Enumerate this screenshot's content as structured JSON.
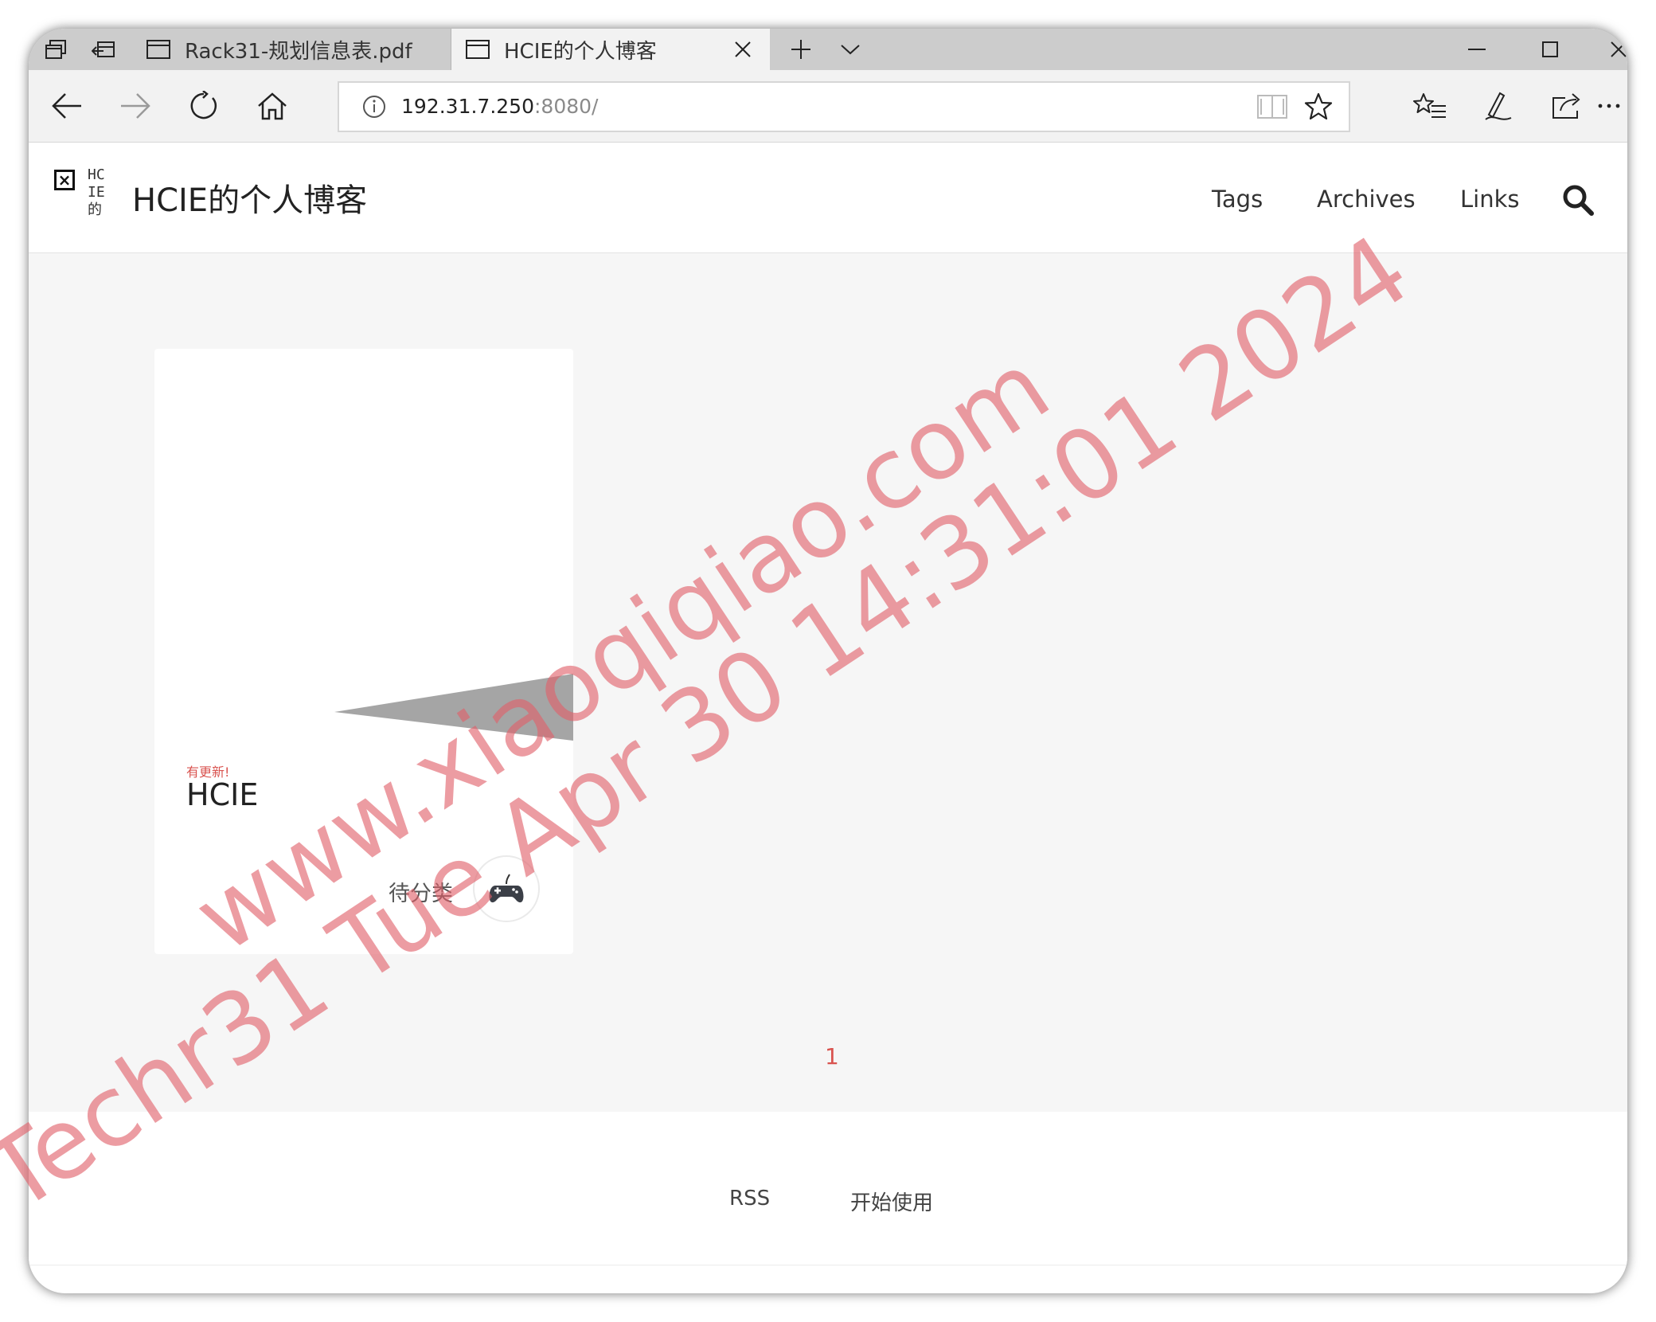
{
  "browser": {
    "tabs": [
      {
        "title": "Rack31-规划信息表.pdf",
        "active": false
      },
      {
        "title": "HCIE的个人博客",
        "active": true
      }
    ],
    "address": {
      "host": "192.31.7.250",
      "port_path": ":8080/"
    }
  },
  "site": {
    "logo_alt": "HCIE的",
    "title": "HCIE的个人博客",
    "nav": [
      "Tags",
      "Archives",
      "Links"
    ]
  },
  "post": {
    "badge": "有更新!",
    "title": "HCIE",
    "category": "待分类"
  },
  "pagination": {
    "current": "1"
  },
  "footer": {
    "links": [
      "RSS",
      "开始使用"
    ]
  },
  "watermark": {
    "line1": "www.xiaoqiqiao.com",
    "line2": "Techr31 Tue Apr 30 14:31:01 2024"
  },
  "colors": {
    "accent": "#d9534f",
    "watermark": "#e15f69",
    "chrome": "#cccccc",
    "page_bg": "#f6f6f6"
  }
}
